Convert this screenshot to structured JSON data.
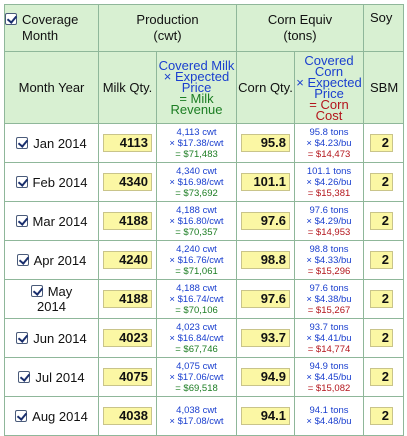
{
  "header": {
    "coverage_line1": "Coverage",
    "coverage_line2": "Month",
    "production_line1": "Production",
    "production_line2": "(cwt)",
    "corn_line1": "Corn Equiv",
    "corn_line2": "(tons)",
    "soy_partial": "Soy"
  },
  "subheader": {
    "month_year": "Month Year",
    "milk_qty": "Milk Qty.",
    "milk_formula": {
      "l1": "Covered Milk",
      "l2": "× Expected",
      "l3": "Price",
      "l4": "= Milk",
      "l5": "Revenue"
    },
    "corn_qty": "Corn Qty.",
    "corn_formula": {
      "l1": "Covered Corn",
      "l2": "× Expected",
      "l3": "Price",
      "l4": "= Corn Cost"
    },
    "sbm_partial": "SBM"
  },
  "rows": [
    {
      "month": "Jan 2014",
      "month_l1": "Jan 2014",
      "month_l2": "",
      "milk_qty": "4113",
      "milk_l1": "4,113 cwt",
      "milk_l2": "× $17.38/cwt",
      "milk_total": "= $71,483",
      "corn_qty": "95.8",
      "corn_l1": "95.8 tons",
      "corn_l2": "× $4.23/bu",
      "corn_total": "= $14,473",
      "sbm_qty": "2"
    },
    {
      "month": "Feb 2014",
      "month_l1": "Feb 2014",
      "month_l2": "",
      "milk_qty": "4340",
      "milk_l1": "4,340 cwt",
      "milk_l2": "× $16.98/cwt",
      "milk_total": "= $73,692",
      "corn_qty": "101.1",
      "corn_l1": "101.1 tons",
      "corn_l2": "× $4.26/bu",
      "corn_total": "= $15,381",
      "sbm_qty": "2"
    },
    {
      "month": "Mar 2014",
      "month_l1": "Mar 2014",
      "month_l2": "",
      "milk_qty": "4188",
      "milk_l1": "4,188 cwt",
      "milk_l2": "× $16.80/cwt",
      "milk_total": "= $70,357",
      "corn_qty": "97.6",
      "corn_l1": "97.6 tons",
      "corn_l2": "× $4.29/bu",
      "corn_total": "= $14,953",
      "sbm_qty": "2"
    },
    {
      "month": "Apr 2014",
      "month_l1": "Apr 2014",
      "month_l2": "",
      "milk_qty": "4240",
      "milk_l1": "4,240 cwt",
      "milk_l2": "× $16.76/cwt",
      "milk_total": "= $71,061",
      "corn_qty": "98.8",
      "corn_l1": "98.8 tons",
      "corn_l2": "× $4.33/bu",
      "corn_total": "= $15,296",
      "sbm_qty": "2"
    },
    {
      "month": "May 2014",
      "month_l1": "May",
      "month_l2": "2014",
      "milk_qty": "4188",
      "milk_l1": "4,188 cwt",
      "milk_l2": "× $16.74/cwt",
      "milk_total": "= $70,106",
      "corn_qty": "97.6",
      "corn_l1": "97.6 tons",
      "corn_l2": "× $4.38/bu",
      "corn_total": "= $15,267",
      "sbm_qty": "2"
    },
    {
      "month": "Jun 2014",
      "month_l1": "Jun 2014",
      "month_l2": "",
      "milk_qty": "4023",
      "milk_l1": "4,023 cwt",
      "milk_l2": "× $16.84/cwt",
      "milk_total": "= $67,746",
      "corn_qty": "93.7",
      "corn_l1": "93.7 tons",
      "corn_l2": "× $4.41/bu",
      "corn_total": "= $14,774",
      "sbm_qty": "2"
    },
    {
      "month": "Jul 2014",
      "month_l1": "Jul 2014",
      "month_l2": "",
      "milk_qty": "4075",
      "milk_l1": "4,075 cwt",
      "milk_l2": "× $17.06/cwt",
      "milk_total": "= $69,518",
      "corn_qty": "94.9",
      "corn_l1": "94.9 tons",
      "corn_l2": "× $4.45/bu",
      "corn_total": "= $15,082",
      "sbm_qty": "2"
    },
    {
      "month": "Aug 2014",
      "month_l1": "Aug 2014",
      "month_l2": "",
      "milk_qty": "4038",
      "milk_l1": "4,038 cwt",
      "milk_l2": "× $17.08/cwt",
      "milk_total": "",
      "corn_qty": "94.1",
      "corn_l1": "94.1 tons",
      "corn_l2": "× $4.48/bu",
      "corn_total": "",
      "sbm_qty": "2"
    }
  ]
}
